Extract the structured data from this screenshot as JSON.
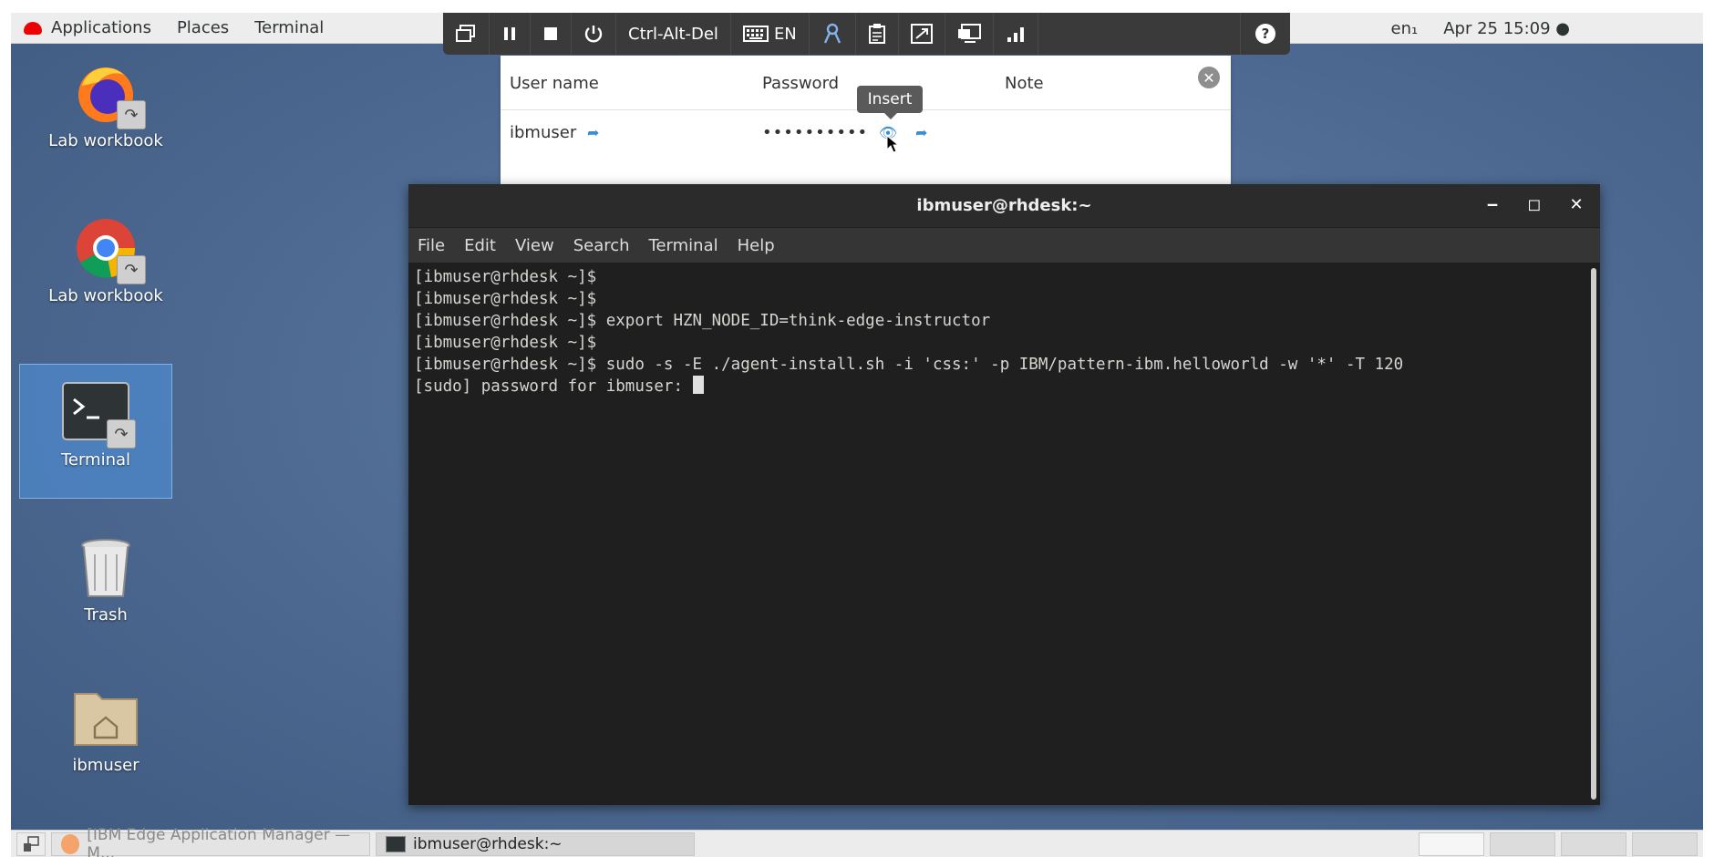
{
  "topbar": {
    "applications": "Applications",
    "places": "Places",
    "terminal": "Terminal",
    "input_method": "en₁",
    "datetime": "Apr 25  15:09 ●",
    "icons": [
      "network-icon",
      "volume-icon",
      "power-icon"
    ]
  },
  "remote_toolbar": {
    "ctrl_alt_del": "Ctrl-Alt-Del",
    "keyboard_lang": "EN",
    "help": "?"
  },
  "credentials": {
    "headers": {
      "username": "User name",
      "password": "Password",
      "note": "Note"
    },
    "row": {
      "username": "ibmuser",
      "password": "••••••••••"
    },
    "tooltip": "Insert"
  },
  "desktop": {
    "icons": [
      {
        "label": "Lab workbook"
      },
      {
        "label": "Lab workbook"
      },
      {
        "label": "Terminal"
      },
      {
        "label": "Trash"
      },
      {
        "label": "ibmuser"
      }
    ]
  },
  "terminal": {
    "title": "ibmuser@rhdesk:~",
    "menu": [
      "File",
      "Edit",
      "View",
      "Search",
      "Terminal",
      "Help"
    ],
    "lines": [
      "[ibmuser@rhdesk ~]$",
      "[ibmuser@rhdesk ~]$",
      "[ibmuser@rhdesk ~]$ export HZN_NODE_ID=think-edge-instructor",
      "[ibmuser@rhdesk ~]$",
      "[ibmuser@rhdesk ~]$ sudo -s -E ./agent-install.sh -i 'css:' -p IBM/pattern-ibm.helloworld -w '*' -T 120",
      "[sudo] password for ibmuser: "
    ]
  },
  "taskbar": {
    "tasks": [
      {
        "label": "[IBM Edge Application Manager — M..."
      },
      {
        "label": "ibmuser@rhdesk:~"
      }
    ]
  },
  "colors": {
    "desktop": "#4f6a8f",
    "terminal_bg": "#1f1f1f",
    "toolbar": "#3a3a3a",
    "link": "#3b8ed0"
  }
}
